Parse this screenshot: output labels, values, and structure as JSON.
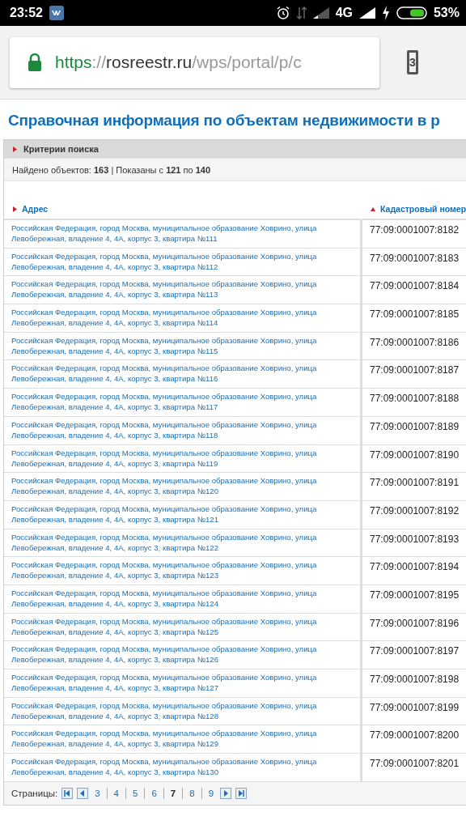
{
  "status_bar": {
    "time": "23:52",
    "network": "4G",
    "battery": "53%"
  },
  "browser": {
    "url": {
      "scheme": "https",
      "separator": "://",
      "host": "rosreestr.ru",
      "path": "/wps/portal/p/c"
    },
    "tab_count": "3"
  },
  "page": {
    "title": "Справочная информация по объектам недвижимости в р",
    "criteria": {
      "label": "Критерии поиска",
      "expanded": false
    },
    "summary": "Найдено объектов: **163** | Показаны с **121** по **140**",
    "table": {
      "columns": [
        {
          "label": "Адрес",
          "sorted": false
        },
        {
          "label": "Кадастровый номер",
          "sorted": true
        }
      ],
      "rows": [
        {
          "address": "Российская Федерация, город Москва, муниципальное образование Ховрино, улица Левобережная, владение 4, 4А, корпус 3, квартира №111",
          "number": "77:09:0001007:8182"
        },
        {
          "address": "Российская Федерация, город Москва, муниципальное образование Ховрино, улица Левобережная, владение 4, 4А, корпус 3, квартира №112",
          "number": "77:09:0001007:8183"
        },
        {
          "address": "Российская Федерация, город Москва, муниципальное образование Ховрино, улица Левобережная, владение 4, 4А, корпус 3, квартира №113",
          "number": "77:09:0001007:8184"
        },
        {
          "address": "Российская Федерация, город Москва, муниципальное образование Ховрино, улица Левобережная, владение 4, 4А, корпус 3, квартира №114",
          "number": "77:09:0001007:8185"
        },
        {
          "address": "Российская Федерация, город Москва, муниципальное образование Ховрино, улица Левобережная, владение 4, 4А, корпус 3, квартира №115",
          "number": "77:09:0001007:8186"
        },
        {
          "address": "Российская Федерация, город Москва, муниципальное образование Ховрино, улица Левобережная, владение 4, 4А, корпус 3, квартира №116",
          "number": "77:09:0001007:8187"
        },
        {
          "address": "Российская Федерация, город Москва, муниципальное образование Ховрино, улица Левобережная, владение 4, 4А, корпус 3, квартира №117",
          "number": "77:09:0001007:8188"
        },
        {
          "address": "Российская Федерация, город Москва, муниципальное образование Ховрино, улица Левобережная, владение 4, 4А, корпус 3, квартира №118",
          "number": "77:09:0001007:8189"
        },
        {
          "address": "Российская Федерация, город Москва, муниципальное образование Ховрино, улица Левобережная, владение 4, 4А, корпус 3, квартира №119",
          "number": "77:09:0001007:8190"
        },
        {
          "address": "Российская Федерация, город Москва, муниципальное образование Ховрино, улица Левобережная, владение 4, 4А, корпус 3, квартира №120",
          "number": "77:09:0001007:8191"
        },
        {
          "address": "Российская Федерация, город Москва, муниципальное образование Ховрино, улица Левобережная, владение 4, 4А, корпус 3, квартира №121",
          "number": "77:09:0001007:8192"
        },
        {
          "address": "Российская Федерация, город Москва, муниципальное образование Ховрино, улица Левобережная, владение 4, 4А, корпус 3, квартира №122",
          "number": "77:09:0001007:8193"
        },
        {
          "address": "Российская Федерация, город Москва, муниципальное образование Ховрино, улица Левобережная, владение 4, 4А, корпус 3, квартира №123",
          "number": "77:09:0001007:8194"
        },
        {
          "address": "Российская Федерация, город Москва, муниципальное образование Ховрино, улица Левобережная, владение 4, 4А, корпус 3, квартира №124",
          "number": "77:09:0001007:8195"
        },
        {
          "address": "Российская Федерация, город Москва, муниципальное образование Ховрино, улица Левобережная, владение 4, 4А, корпус 3, квартира №125",
          "number": "77:09:0001007:8196"
        },
        {
          "address": "Российская Федерация, город Москва, муниципальное образование Ховрино, улица Левобережная, владение 4, 4А, корпус 3, квартира №126",
          "number": "77:09:0001007:8197"
        },
        {
          "address": "Российская Федерация, город Москва, муниципальное образование Ховрино, улица Левобережная, владение 4, 4А, корпус 3, квартира №127",
          "number": "77:09:0001007:8198"
        },
        {
          "address": "Российская Федерация, город Москва, муниципальное образование Ховрино, улица Левобережная, владение 4, 4А, корпус 3, квартира №128",
          "number": "77:09:0001007:8199"
        },
        {
          "address": "Российская Федерация, город Москва, муниципальное образование Ховрино, улица Левобережная, владение 4, 4А, корпус 3, квартира №129",
          "number": "77:09:0001007:8200"
        },
        {
          "address": "Российская Федерация, город Москва, муниципальное образование Ховрино, улица Левобережная, владение 4, 4А, корпус 3, квартира №130",
          "number": "77:09:0001007:8201"
        }
      ]
    },
    "pagination": {
      "label": "Страницы:",
      "pages": [
        {
          "label": "3",
          "selected": false
        },
        {
          "label": "4",
          "selected": false
        },
        {
          "label": "5",
          "selected": false
        },
        {
          "label": "6",
          "selected": false
        },
        {
          "label": "7",
          "selected": true
        },
        {
          "label": "8",
          "selected": false
        },
        {
          "label": "9",
          "selected": false
        }
      ]
    }
  }
}
